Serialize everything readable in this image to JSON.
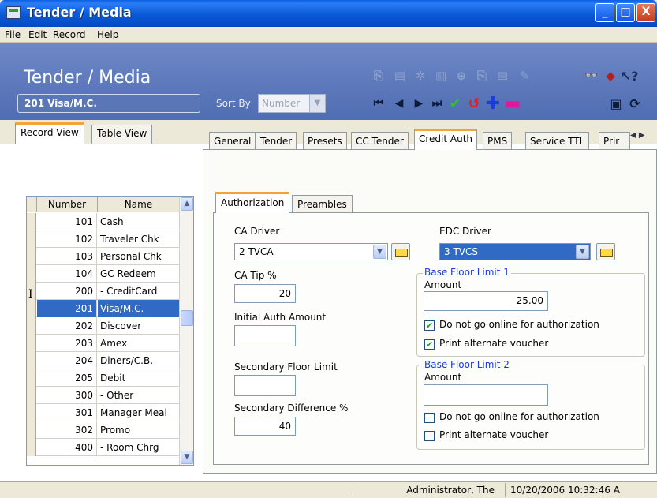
{
  "window": {
    "title": "Tender / Media",
    "controls": [
      "_",
      "□",
      "X"
    ]
  },
  "menu": [
    "File",
    "Edit",
    "Record",
    "Help"
  ],
  "header": {
    "title": "Tender / Media",
    "current_record": "201 Visa/M.C.",
    "sort_by_label": "Sort By",
    "sort_by_value": "Number"
  },
  "view_tabs": [
    "Record View",
    "Table View"
  ],
  "grid": {
    "columns": [
      "Number",
      "Name"
    ],
    "rows": [
      {
        "number": "101",
        "name": "Cash"
      },
      {
        "number": "102",
        "name": "Traveler Chk"
      },
      {
        "number": "103",
        "name": "Personal Chk"
      },
      {
        "number": "104",
        "name": "GC Redeem"
      },
      {
        "number": "200",
        "name": "- CreditCard"
      },
      {
        "number": "201",
        "name": "Visa/M.C."
      },
      {
        "number": "202",
        "name": "Discover"
      },
      {
        "number": "203",
        "name": "Amex"
      },
      {
        "number": "204",
        "name": "Diners/C.B."
      },
      {
        "number": "205",
        "name": "Debit"
      },
      {
        "number": "300",
        "name": "- Other"
      },
      {
        "number": "301",
        "name": "Manager Meal"
      },
      {
        "number": "302",
        "name": "Promo"
      },
      {
        "number": "400",
        "name": "- Room Chrg"
      }
    ],
    "selected_row_marker": "I"
  },
  "tabs": [
    "General",
    "Tender",
    "Presets",
    "CC Tender",
    "Credit Auth",
    "PMS",
    "Service TTL",
    "Prir"
  ],
  "subtabs": [
    "Authorization",
    "Preambles"
  ],
  "form": {
    "ca_driver_label": "CA Driver",
    "ca_driver_value": "2  TVCA",
    "edc_driver_label": "EDC Driver",
    "edc_driver_value": "3  TVCS",
    "ca_tip_label": "CA Tip %",
    "ca_tip_value": "20",
    "initial_auth_label": "Initial Auth Amount",
    "initial_auth_value": "",
    "secondary_floor_label": "Secondary Floor Limit",
    "secondary_floor_value": "",
    "secondary_diff_label": "Secondary Difference %",
    "secondary_diff_value": "40",
    "bfl1": {
      "title": "Base Floor Limit 1",
      "amount_label": "Amount",
      "amount_value": "25.00",
      "cb1_label": "Do not go online for authorization",
      "cb2_label": "Print alternate voucher"
    },
    "bfl2": {
      "title": "Base Floor Limit 2",
      "amount_label": "Amount",
      "amount_value": "",
      "cb1_label": "Do not go online for authorization",
      "cb2_label": "Print alternate voucher"
    }
  },
  "status": {
    "user": "Administrator, The",
    "datetime": "10/20/2006 10:32:46 A"
  },
  "colors": {
    "title_bar": "#0a59d6",
    "header": "#5b76b9",
    "selection": "#316ac5",
    "tab_accent": "#f2a33a",
    "group_title": "#1a3bd6"
  },
  "icons": [
    "app-icon",
    "first-record-icon",
    "prev-record-icon",
    "next-record-icon",
    "last-record-icon",
    "save-check-icon",
    "undo-icon",
    "add-record-icon",
    "delete-record-icon",
    "find-binoculars-icon",
    "help-pointer-icon"
  ]
}
